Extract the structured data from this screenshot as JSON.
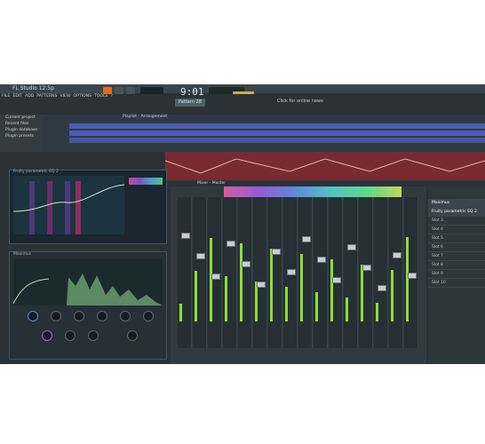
{
  "window": {
    "title": "FL Studio 12.5p"
  },
  "menu": [
    "FILE",
    "EDIT",
    "ADD",
    "PATTERNS",
    "VIEW",
    "OPTIONS",
    "TOOLS",
    "?"
  ],
  "transport": {
    "time": "9:01",
    "pattern": "Pattern 28",
    "hint": "Click for online news"
  },
  "browser": {
    "items": [
      "Current project",
      "Recent files",
      "Plugin database",
      "Plugin presets"
    ]
  },
  "playlist": {
    "title": "Playlist - Arrangement"
  },
  "eq": {
    "name": "Fruity parametric EQ 2"
  },
  "wave": {
    "name": "Maximus"
  },
  "mixer": {
    "title": "Mixer - Master"
  },
  "effects_slots": {
    "items": [
      "Maximus",
      "Fruity parametric EQ 2",
      "Slot 3",
      "Slot 4",
      "Slot 5",
      "Slot 6",
      "Slot 7",
      "Slot 8",
      "Slot 9",
      "Slot 10"
    ]
  },
  "colors": {
    "accent": "#8fdc3a",
    "playlist_clip": "#4e5cb0",
    "automation": "#7a2a32"
  }
}
